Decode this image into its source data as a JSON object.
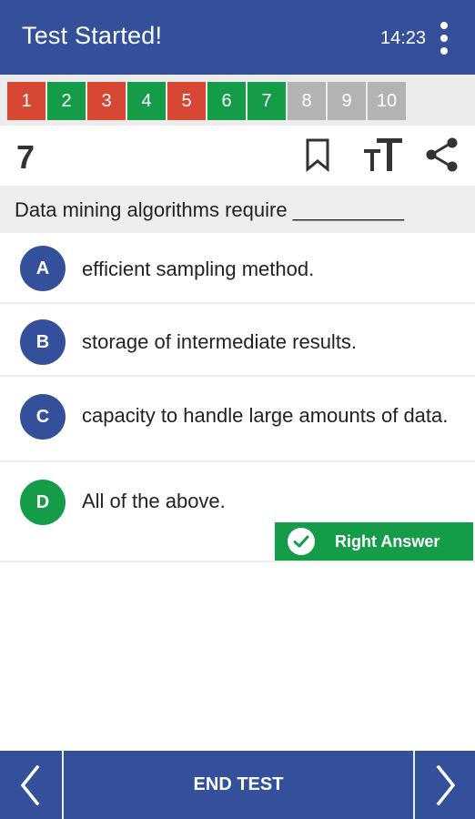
{
  "appbar": {
    "title": "Test Started!",
    "clock": "14:23"
  },
  "question_strip": {
    "items": [
      {
        "label": "1",
        "status": "wrong"
      },
      {
        "label": "2",
        "status": "right"
      },
      {
        "label": "3",
        "status": "wrong"
      },
      {
        "label": "4",
        "status": "right"
      },
      {
        "label": "5",
        "status": "wrong"
      },
      {
        "label": "6",
        "status": "right"
      },
      {
        "label": "7",
        "status": "right"
      },
      {
        "label": "8",
        "status": "unanswered"
      },
      {
        "label": "9",
        "status": "unanswered"
      },
      {
        "label": "10",
        "status": "unanswered"
      }
    ]
  },
  "toolbar": {
    "question_number": "7",
    "icons": [
      "bookmark-icon",
      "text-size-icon",
      "share-icon"
    ]
  },
  "question": {
    "text": "Data mining algorithms require __________"
  },
  "options": [
    {
      "letter": "A",
      "text": "efficient sampling method.",
      "state": "normal"
    },
    {
      "letter": "B",
      "text": "storage of intermediate results.",
      "state": "normal"
    },
    {
      "letter": "C",
      "text": "capacity to handle large amounts of data.",
      "state": "normal"
    },
    {
      "letter": "D",
      "text": "All of the above.",
      "state": "correct"
    }
  ],
  "feedback": {
    "label": "Right Answer"
  },
  "bottombar": {
    "end_test_label": "END TEST"
  },
  "colors": {
    "primary": "#34509a",
    "wrong": "#d64833",
    "right": "#159c48",
    "unanswered": "#b3b3b3"
  }
}
